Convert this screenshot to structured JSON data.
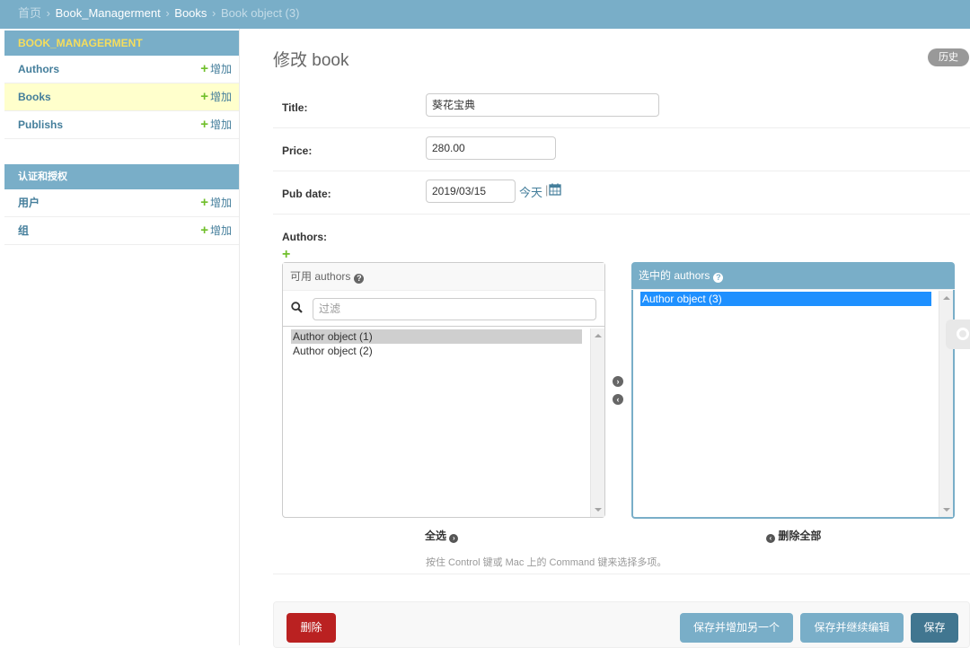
{
  "breadcrumbs": {
    "home": "首页",
    "separator": "›",
    "app": "Book_Managerment",
    "model": "Books",
    "current": "Book object (3)"
  },
  "sidebar": {
    "modules": [
      {
        "caption": "BOOK_MANAGERMENT",
        "rows": [
          {
            "label": "Authors",
            "add": "增加",
            "selected": false
          },
          {
            "label": "Books",
            "add": "增加",
            "selected": true
          },
          {
            "label": "Publishs",
            "add": "增加",
            "selected": false
          }
        ]
      },
      {
        "caption": "认证和授权",
        "rows": [
          {
            "label": "用户",
            "add": "增加"
          },
          {
            "label": "组",
            "add": "增加"
          }
        ]
      }
    ]
  },
  "content": {
    "title_verb": "修改",
    "title_model": "book",
    "history_label": "历史"
  },
  "form": {
    "title": {
      "label": "Title:",
      "value": "葵花宝典"
    },
    "price": {
      "label": "Price:",
      "value": "280.00"
    },
    "pub_date": {
      "label": "Pub date:",
      "value": "2019/03/15",
      "today": "今天",
      "pipe": "|"
    },
    "authors": {
      "label": "Authors:",
      "add_related": "+",
      "available": {
        "title": "可用 authors",
        "filter_placeholder": "过滤",
        "options": [
          "Author object (1)",
          "Author object (2)"
        ]
      },
      "chosen": {
        "title": "选中的 authors",
        "options": [
          "Author object (3)"
        ]
      },
      "choose_all": "全选",
      "clear_all": "删除全部",
      "help_text": "按住 Control 键或 Mac 上的 Command 键来选择多项。"
    }
  },
  "actions": {
    "delete": "删除",
    "save_add_another": "保存并增加另一个",
    "save_continue": "保存并继续编辑",
    "save": "保存"
  },
  "icons": {
    "help": "question-circle-icon",
    "search": "search-icon",
    "calendar": "calendar-icon",
    "add": "plus-icon",
    "move_right": "arrow-right-circle-icon",
    "move_left": "arrow-left-circle-icon"
  },
  "colors": {
    "header": "#79aec8",
    "app_caption": "#f5dd5d",
    "link": "#447e9b",
    "add_green": "#70bf2b",
    "delete_red": "#ba2121",
    "save_dark": "#417690",
    "selected_row": "#ffffcc",
    "option_selected": "#1e90ff"
  }
}
